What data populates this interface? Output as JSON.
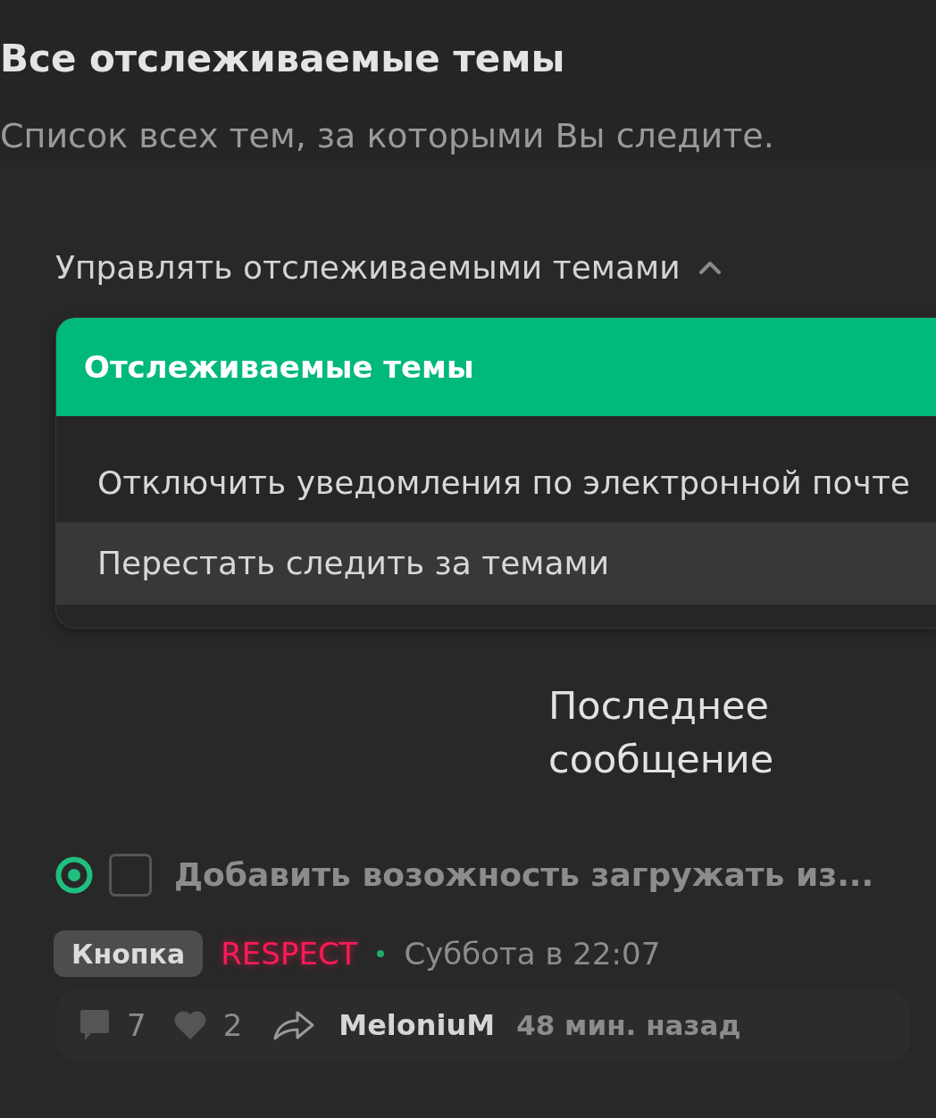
{
  "page": {
    "title": "Все отслеживаемые темы",
    "subtitle": "Список всех тем, за которыми Вы следите."
  },
  "manage_toggle": {
    "label": "Управлять отслеживаемыми темами",
    "expanded": true
  },
  "dropdown": {
    "header": "Отслеживаемые темы",
    "items": [
      {
        "label": "Отключить уведомления по электронной почте",
        "selected": false
      },
      {
        "label": "Перестать следить за темами",
        "selected": true
      }
    ]
  },
  "column_header": "Последнее сообщение",
  "topics": [
    {
      "unread": true,
      "checked": false,
      "title": "Добавить возожность загружать из...",
      "prefix": "Кнопка",
      "author": "RESPECT",
      "date": "Суббота в 22:07",
      "replies": "7",
      "likes": "2",
      "last_poster": "MeloniuM",
      "last_time": "48 мин. назад"
    }
  ]
}
